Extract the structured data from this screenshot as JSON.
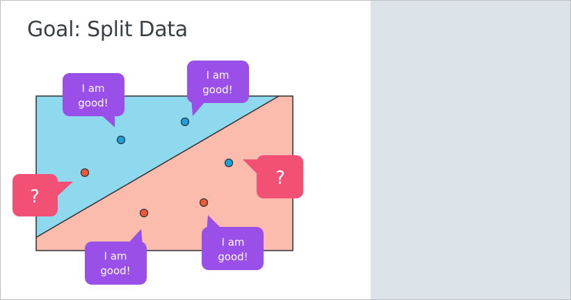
{
  "slide": {
    "title": "Goal: Split Data"
  },
  "diagram": {
    "colors": {
      "top_region": "#8fd9ee",
      "bottom_region": "#fbbcad",
      "border": "#2b2f33",
      "point_blue": "#1ba3d9",
      "point_red": "#e85a3a",
      "bubble_good": "#9a4fe8",
      "bubble_question": "#f25075"
    },
    "bubbles": {
      "good_1": {
        "line1": "I am",
        "line2": "good!"
      },
      "good_2": {
        "line1": "I am",
        "line2": "good!"
      },
      "good_3": {
        "line1": "I am",
        "line2": "good!"
      },
      "good_4": {
        "line1": "I am",
        "line2": "good!"
      },
      "question_left": "?",
      "question_right": "?"
    }
  }
}
